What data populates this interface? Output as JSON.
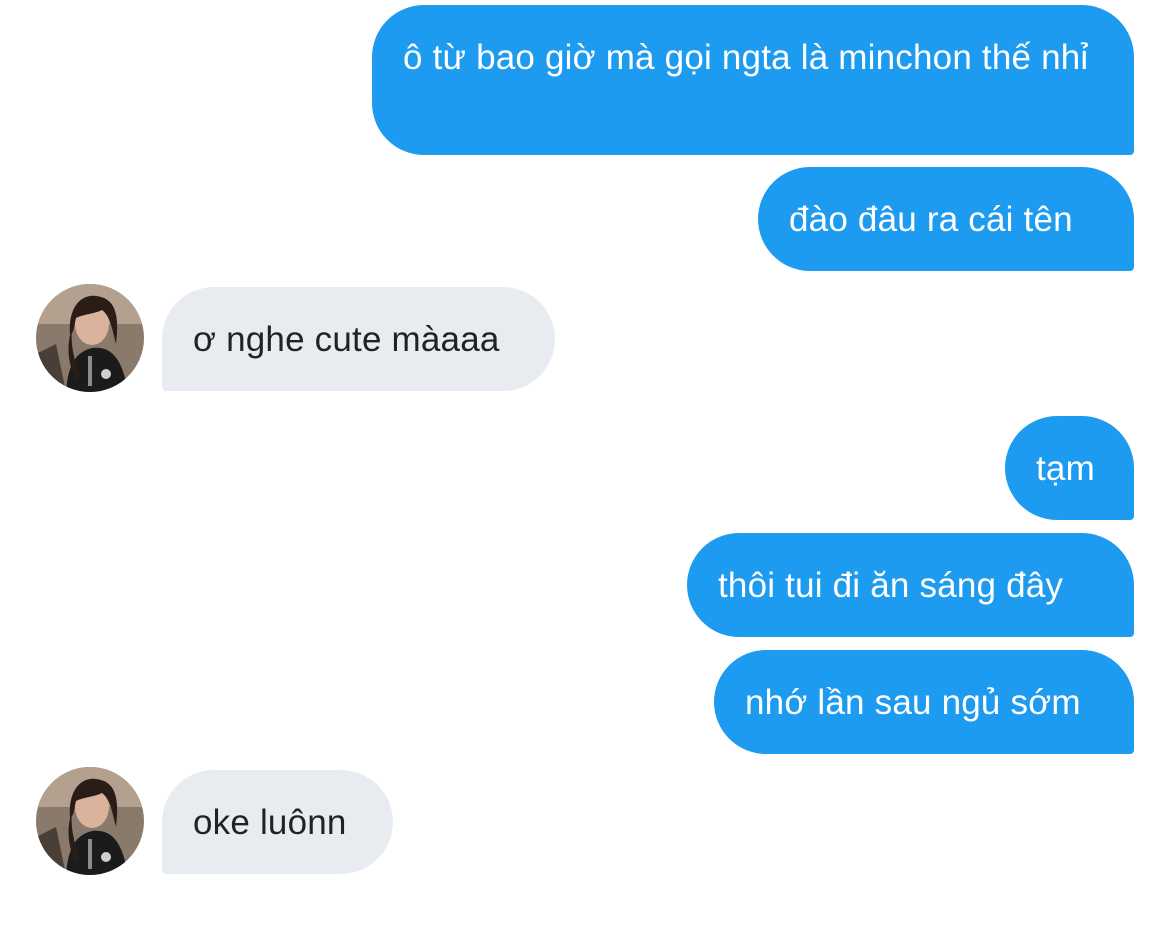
{
  "conversation": {
    "messages": [
      {
        "direction": "sent",
        "text": "ô từ bao giờ mà gọi ngta là minchon thế nhỉ"
      },
      {
        "direction": "sent",
        "text": "đào đâu ra cái tên"
      },
      {
        "direction": "received",
        "text": "ơ nghe cute màaaa"
      },
      {
        "direction": "sent",
        "text": "tạm"
      },
      {
        "direction": "sent",
        "text": "thôi tui đi ăn sáng đây"
      },
      {
        "direction": "sent",
        "text": "nhớ lần sau ngủ sớm"
      },
      {
        "direction": "received",
        "text": "oke luônn"
      }
    ]
  },
  "colors": {
    "sent_bubble": "#1d9bf0",
    "received_bubble": "#e8ecf0",
    "sent_text": "#ffffff",
    "received_text": "#1f2328"
  },
  "icons": {
    "contact_avatar": "profile-photo"
  }
}
